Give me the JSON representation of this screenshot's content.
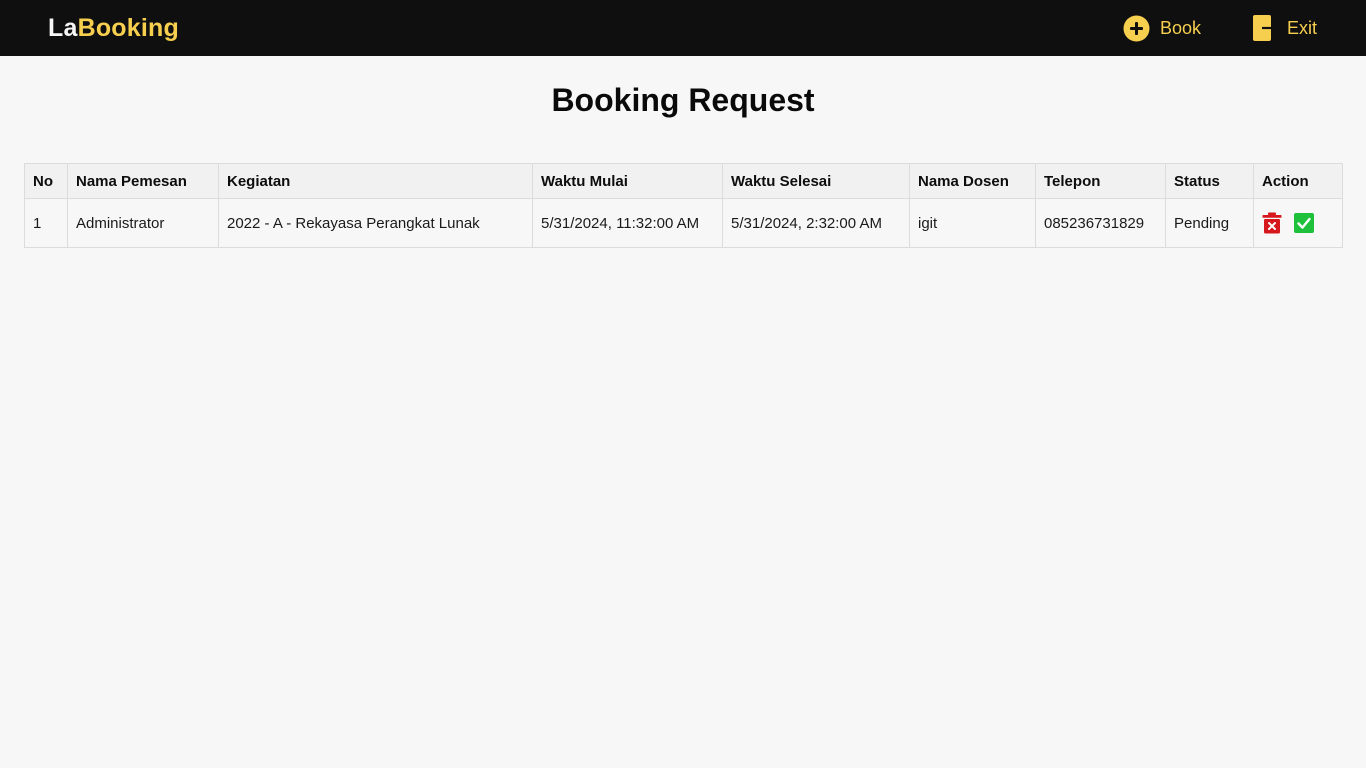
{
  "navbar": {
    "brand_prefix": "La",
    "brand_suffix": "Booking",
    "links": [
      {
        "label": "Book",
        "icon": "plus-circle-icon"
      },
      {
        "label": "Exit",
        "icon": "logout-icon"
      }
    ]
  },
  "page": {
    "title": "Booking Request"
  },
  "table": {
    "headers": [
      "No",
      "Nama Pemesan",
      "Kegiatan",
      "Waktu Mulai",
      "Waktu Selesai",
      "Nama Dosen",
      "Telepon",
      "Status",
      "Action"
    ],
    "rows": [
      {
        "no": "1",
        "nama_pemesan": "Administrator",
        "kegiatan": "2022 - A - Rekayasa Perangkat Lunak",
        "waktu_mulai": "5/31/2024, 11:32:00 AM",
        "waktu_selesai": "5/31/2024, 2:32:00 AM",
        "nama_dosen": "igit",
        "telepon": "085236731829",
        "status": "Pending",
        "actions": [
          {
            "icon": "delete-icon",
            "color": "#d7171e"
          },
          {
            "icon": "approve-check-icon",
            "color": "#1fc13c"
          }
        ]
      }
    ]
  },
  "colors": {
    "navbar_bg": "#0f0f0f",
    "accent": "#f6cf4f",
    "page_bg": "#f7f7f7"
  }
}
